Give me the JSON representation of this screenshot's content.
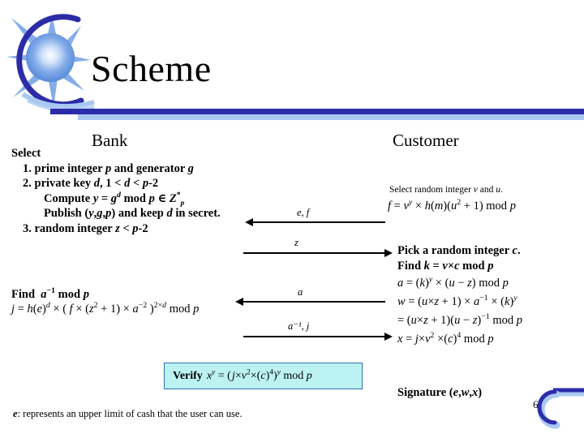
{
  "slide": {
    "title": "Scheme",
    "page_number": "6"
  },
  "columns": {
    "bank_heading": "Bank",
    "customer_heading": "Customer"
  },
  "bank": {
    "select_label": "Select",
    "step1": "1. prime integer p and generator g",
    "step2": "2. private key d, 1 < d < p-2",
    "compute": "Compute y = g^d mod p ∈ Z*p",
    "publish": "Publish (y,g,p) and keep d in secret.",
    "step3": "3. random integer z < p-2",
    "find_label": "Find",
    "find_expr": "a⁻¹ mod p",
    "j_expr": "j = h(e)^d × ( f × (z² + 1) × a⁻² )^(2×d) mod p"
  },
  "customer": {
    "select_random": "Select random integer v and u.",
    "f_expr": "f = v^y × h(m)(u² + 1) mod p",
    "pick_c": "Pick a random integer c.",
    "find_k": "Find k = v × c mod p",
    "a_expr": "a = (k)^y × (u − z) mod p",
    "w_expr": "w = (u × z + 1) × a⁻¹ × (k)^y",
    "w_expr2": "= (u × z + 1)(u − z)⁻¹ mod p",
    "x_expr": "x = j × v² × (c)⁴ mod p",
    "signature": "Signature (e,w,x)"
  },
  "arrows": [
    {
      "label": "e, f",
      "direction": "left"
    },
    {
      "label": "z",
      "direction": "right"
    },
    {
      "label": "a",
      "direction": "left"
    },
    {
      "label": "a⁻¹, j",
      "direction": "right"
    }
  ],
  "verify": {
    "label": "Verify",
    "expr": "x^y = ( j × v² × (c)⁴ )^y mod p"
  },
  "footer": {
    "note": "e: represents an upper limit of cash that the user can use."
  },
  "colors": {
    "navy_bar": "#2C2CA8",
    "light_bar": "#A9C8F2",
    "verify_bg": "#BDF2F2",
    "verify_border": "#2C72B8"
  }
}
